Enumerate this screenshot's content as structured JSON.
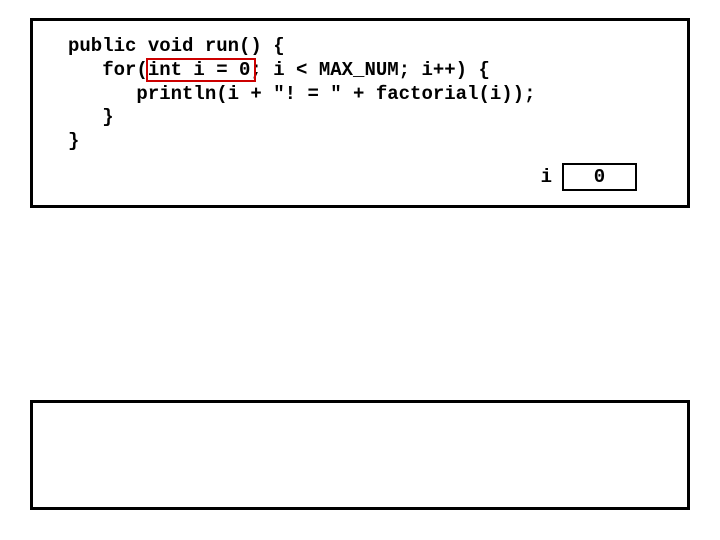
{
  "code": {
    "line1": "public void run() {",
    "line2": "   for(int i = 0; i < MAX_NUM; i++) {",
    "line3": "      println(i + \"! = \" + factorial(i));",
    "line4": "   }",
    "line5": "}"
  },
  "highlight": {
    "text": "int i = 0"
  },
  "variable": {
    "name": "i",
    "value": "0"
  }
}
